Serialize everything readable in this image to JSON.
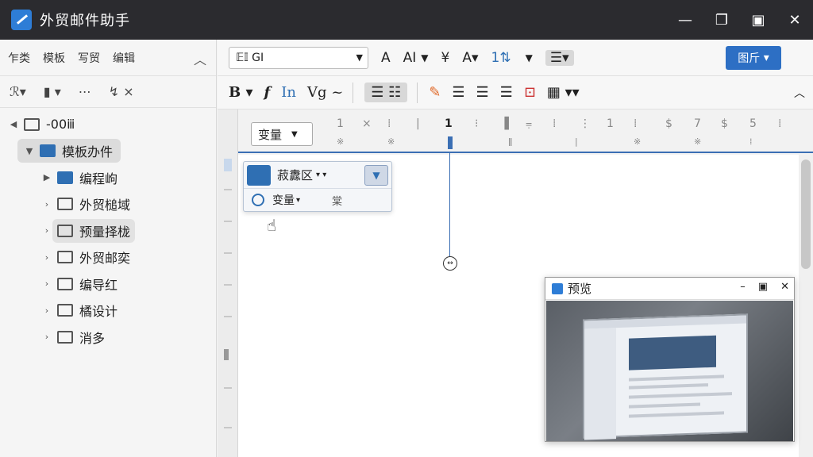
{
  "app": {
    "title": "外贸邮件助手"
  },
  "left": {
    "tabs": [
      "乍类",
      "模板",
      "写贸",
      "编辑"
    ],
    "tree": {
      "root": "-00ⅲ",
      "selected": "模板办件",
      "items": [
        "编程岣",
        "外贸槌域",
        "预量择栊",
        "外贸邮奕",
        "编导红",
        "橘设计",
        "消多"
      ]
    }
  },
  "toolbar1": {
    "font": "𝔼𝕀 GI",
    "image_button": "图斤"
  },
  "ruler": {
    "variable_dropdown": "变量"
  },
  "popup": {
    "row1_label": "菽纛区",
    "row2_label": "变量",
    "row2_extra": "棠"
  },
  "preview": {
    "title": "预览"
  }
}
